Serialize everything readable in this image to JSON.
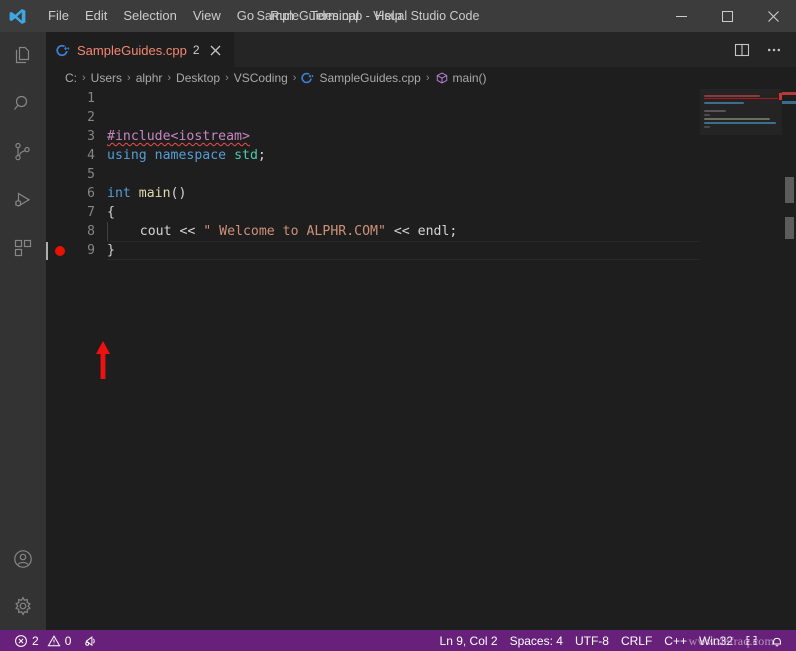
{
  "window": {
    "title": "SampleGuides.cpp - Visual Studio Code",
    "logo_icon": "vscode-logo-icon",
    "minimize_icon": "minimize-icon",
    "maximize_icon": "maximize-icon",
    "close_icon": "close-icon"
  },
  "menubar": {
    "items": [
      {
        "label": "File",
        "name": "menu-file"
      },
      {
        "label": "Edit",
        "name": "menu-edit"
      },
      {
        "label": "Selection",
        "name": "menu-selection"
      },
      {
        "label": "View",
        "name": "menu-view"
      },
      {
        "label": "Go",
        "name": "menu-go"
      },
      {
        "label": "Run",
        "name": "menu-run"
      },
      {
        "label": "Terminal",
        "name": "menu-terminal"
      },
      {
        "label": "Help",
        "name": "menu-help"
      }
    ]
  },
  "activitybar": {
    "items": [
      {
        "name": "activity-explorer",
        "icon": "files-icon",
        "title": "Explorer"
      },
      {
        "name": "activity-search",
        "icon": "search-icon",
        "title": "Search"
      },
      {
        "name": "activity-source-control",
        "icon": "source-control-icon",
        "title": "Source Control"
      },
      {
        "name": "activity-run-debug",
        "icon": "run-and-debug-icon",
        "title": "Run and Debug"
      },
      {
        "name": "activity-extensions",
        "icon": "extensions-icon",
        "title": "Extensions"
      }
    ],
    "bottom": [
      {
        "name": "activity-accounts",
        "icon": "account-icon",
        "title": "Accounts"
      },
      {
        "name": "activity-settings",
        "icon": "gear-icon",
        "title": "Manage"
      }
    ]
  },
  "tabs": {
    "active": {
      "label": "SampleGuides.cpp",
      "problem_count": "2",
      "file_icon": "cpp-file-icon",
      "close_icon": "close-icon"
    },
    "actions": {
      "split_editor_icon": "split-editor-icon",
      "more_actions_icon": "ellipsis-icon"
    }
  },
  "breadcrumbs": {
    "separator": "›",
    "items": [
      {
        "label": "C:",
        "icon": null
      },
      {
        "label": "Users",
        "icon": null
      },
      {
        "label": "alphr",
        "icon": null
      },
      {
        "label": "Desktop",
        "icon": null
      },
      {
        "label": "VSCoding",
        "icon": null
      },
      {
        "label": "SampleGuides.cpp",
        "icon": "cpp-file-icon"
      },
      {
        "label": "main()",
        "icon": "symbol-method-icon"
      }
    ]
  },
  "editor": {
    "language": "cpp",
    "breakpoint_line": 9,
    "cursor_line": 9,
    "lines": [
      {
        "no": "1",
        "text": ""
      },
      {
        "no": "2",
        "text": ""
      },
      {
        "no": "3",
        "text": "#include<iostream>"
      },
      {
        "no": "4",
        "text": "using namespace std;"
      },
      {
        "no": "5",
        "text": ""
      },
      {
        "no": "6",
        "text": "int main()"
      },
      {
        "no": "7",
        "text": "{"
      },
      {
        "no": "8",
        "text": "    cout << \" Welcome to ALPHR.COM\" << endl;"
      },
      {
        "no": "9",
        "text": "}"
      }
    ],
    "colors": {
      "background": "#1e1e1e",
      "foreground": "#d4d4d4",
      "line_number": "#858585",
      "preprocessor": "#c586c0",
      "keyword": "#569cd6",
      "type": "#4ec9b0",
      "function": "#dcdcaa",
      "string": "#ce9178",
      "error_squiggle": "#f14c4c",
      "breakpoint": "#e51400"
    },
    "annotation": {
      "name": "red-arrow-annotation",
      "color": "#ee1111",
      "points_to": "breakpoint-dot-line-9"
    }
  },
  "statusbar": {
    "background": "#68217a",
    "errors": {
      "icon": "error-icon",
      "count": "2"
    },
    "warnings": {
      "icon": "warning-icon",
      "count": "0"
    },
    "golive": {
      "icon": "broadcast-icon",
      "label": ""
    },
    "right_items": [
      {
        "name": "status-cursor-position",
        "label": "Ln 9, Col 2"
      },
      {
        "name": "status-indentation",
        "label": "Spaces: 4"
      },
      {
        "name": "status-encoding",
        "label": "UTF-8"
      },
      {
        "name": "status-eol",
        "label": "CRLF"
      },
      {
        "name": "status-language-mode",
        "label": "C++"
      },
      {
        "name": "status-platform",
        "label": "Win32"
      }
    ],
    "notifications_icon": "bell-icon",
    "remote_icon": "remote-window-icon"
  },
  "watermark": {
    "text": "www.defraq.com"
  }
}
